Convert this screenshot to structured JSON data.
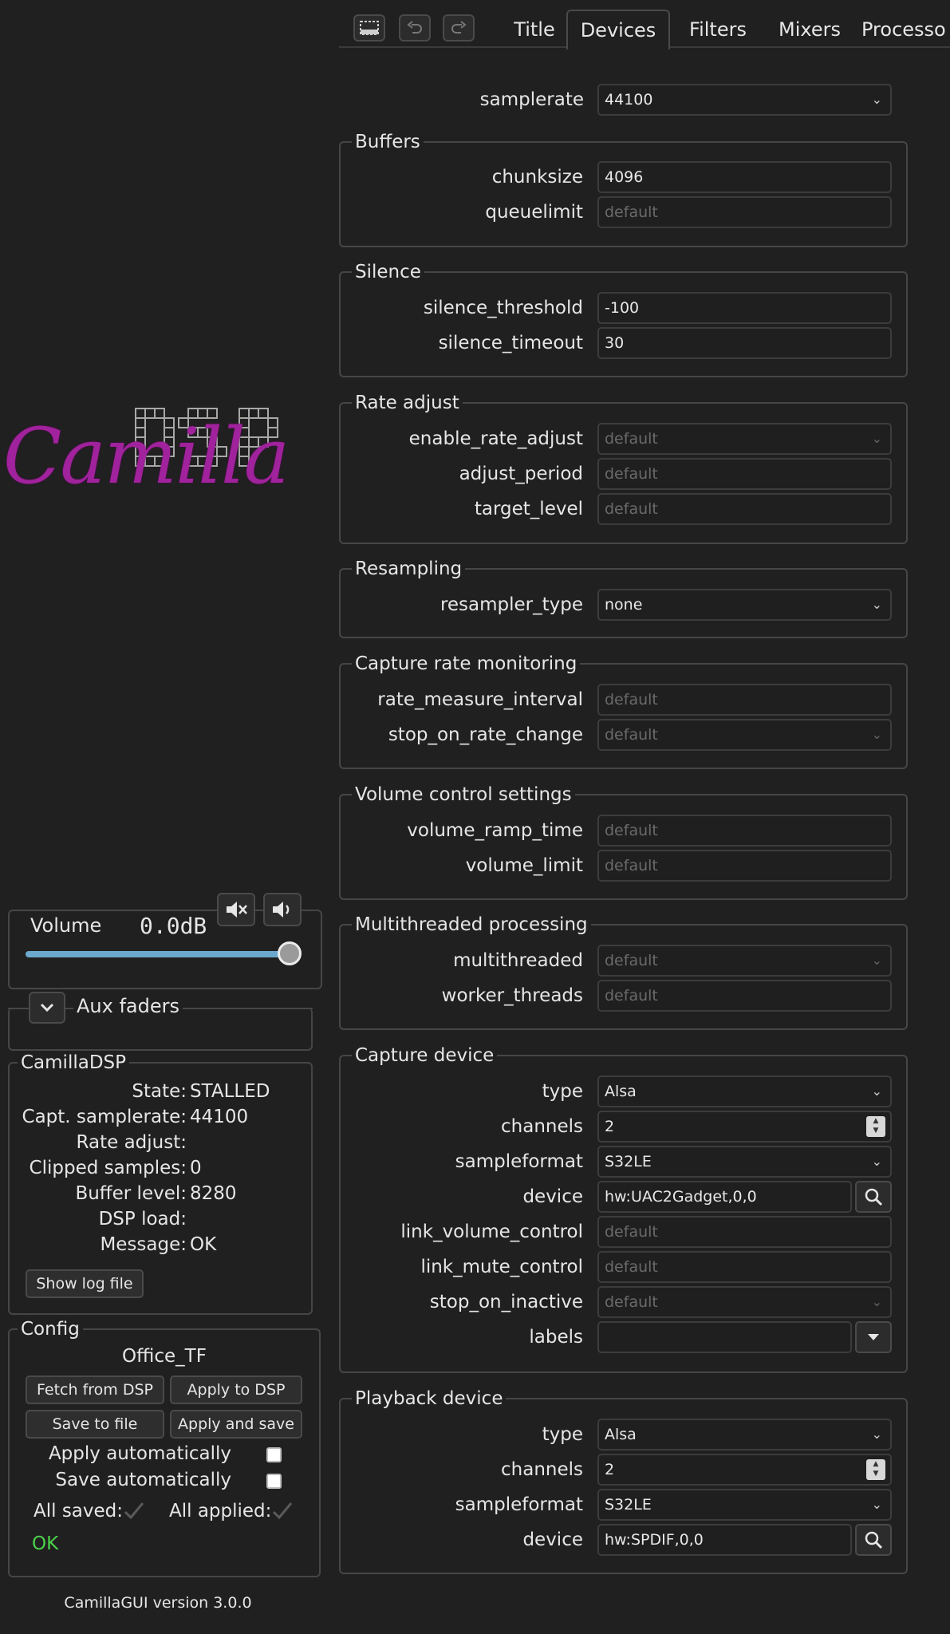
{
  "toolbar": {
    "icons": [
      "select-area-icon",
      "undo-icon",
      "redo-icon"
    ]
  },
  "tabs": [
    {
      "label": "Title",
      "active": false
    },
    {
      "label": "Devices",
      "active": true
    },
    {
      "label": "Filters",
      "active": false
    },
    {
      "label": "Mixers",
      "active": false
    },
    {
      "label": "Processo",
      "active": false
    }
  ],
  "samplerate": {
    "label": "samplerate",
    "value": "44100"
  },
  "buffers": {
    "title": "Buffers",
    "chunksize": {
      "label": "chunksize",
      "value": "4096"
    },
    "queuelimit": {
      "label": "queuelimit",
      "placeholder": "default"
    }
  },
  "silence": {
    "title": "Silence",
    "threshold": {
      "label": "silence_threshold",
      "value": "-100"
    },
    "timeout": {
      "label": "silence_timeout",
      "value": "30"
    }
  },
  "rate_adjust": {
    "title": "Rate adjust",
    "enable": {
      "label": "enable_rate_adjust",
      "placeholder": "default"
    },
    "period": {
      "label": "adjust_period",
      "placeholder": "default"
    },
    "target": {
      "label": "target_level",
      "placeholder": "default"
    }
  },
  "resampling": {
    "title": "Resampling",
    "type": {
      "label": "resampler_type",
      "value": "none"
    }
  },
  "capture_rate": {
    "title": "Capture rate monitoring",
    "interval": {
      "label": "rate_measure_interval",
      "placeholder": "default"
    },
    "stop": {
      "label": "stop_on_rate_change",
      "placeholder": "default"
    }
  },
  "volume_settings": {
    "title": "Volume control settings",
    "ramp": {
      "label": "volume_ramp_time",
      "placeholder": "default"
    },
    "limit": {
      "label": "volume_limit",
      "placeholder": "default"
    }
  },
  "multithread": {
    "title": "Multithreaded processing",
    "enabled": {
      "label": "multithreaded",
      "placeholder": "default"
    },
    "workers": {
      "label": "worker_threads",
      "placeholder": "default"
    }
  },
  "capture": {
    "title": "Capture device",
    "type": {
      "label": "type",
      "value": "Alsa"
    },
    "channels": {
      "label": "channels",
      "value": "2"
    },
    "format": {
      "label": "sampleformat",
      "value": "S32LE"
    },
    "device": {
      "label": "device",
      "value": "hw:UAC2Gadget,0,0"
    },
    "link_volume": {
      "label": "link_volume_control",
      "placeholder": "default"
    },
    "link_mute": {
      "label": "link_mute_control",
      "placeholder": "default"
    },
    "stop_inactive": {
      "label": "stop_on_inactive",
      "placeholder": "default"
    },
    "labels": {
      "label": "labels",
      "value": ""
    }
  },
  "playback": {
    "title": "Playback device",
    "type": {
      "label": "type",
      "value": "Alsa"
    },
    "channels": {
      "label": "channels",
      "value": "2"
    },
    "format": {
      "label": "sampleformat",
      "value": "S32LE"
    },
    "device": {
      "label": "device",
      "value": "hw:SPDIF,0,0"
    }
  },
  "logo": {
    "script": "Camilla",
    "block": "DSP"
  },
  "volume": {
    "title": "Volume",
    "readout": "0.0dB",
    "level": 1.0
  },
  "aux": {
    "title": "Aux faders"
  },
  "status": {
    "title": "CamillaDSP",
    "rows": [
      {
        "label": "State:",
        "value": "STALLED"
      },
      {
        "label": "Capt. samplerate:",
        "value": "44100"
      },
      {
        "label": "Rate adjust:",
        "value": ""
      },
      {
        "label": "Clipped samples:",
        "value": "0"
      },
      {
        "label": "Buffer level:",
        "value": "8280"
      },
      {
        "label": "DSP load:",
        "value": ""
      },
      {
        "label": "Message:",
        "value": "OK"
      }
    ],
    "log_button": "Show log file"
  },
  "config": {
    "title": "Config",
    "name": "Office_TF",
    "fetch": "Fetch from DSP",
    "apply": "Apply to DSP",
    "save": "Save to file",
    "apply_save": "Apply and save",
    "apply_auto": "Apply automatically",
    "save_auto": "Save automatically",
    "all_saved": "All saved:",
    "all_applied": "All applied:",
    "result": "OK"
  },
  "footer": "CamillaGUI version 3.0.0",
  "colors": {
    "accent_green": "#4bd14b",
    "logo_magenta": "#a0229c",
    "slider": "#6ca9cf"
  }
}
